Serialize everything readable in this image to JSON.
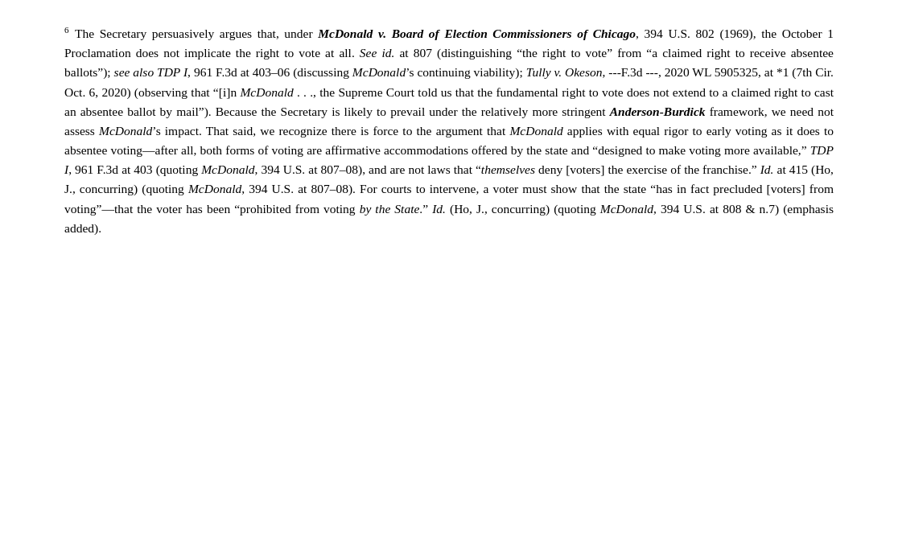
{
  "page": {
    "background_color": "#ffffff",
    "text_color": "#000000"
  },
  "footnote": {
    "number": "6",
    "content": "The Secretary persuasively argues that, under McDonald v. Board of Election Commissioners of Chicago, 394 U.S. 802 (1969), the October 1 Proclamation does not implicate the right to vote at all. See id. at 807 (distinguishing \"the right to vote\" from \"a claimed right to receive absentee ballots\"); see also TDP I, 961 F.3d at 403–06 (discussing McDonald's continuing viability); Tully v. Okeson, ---F.3d ---, 2020 WL 5905325, at *1 (7th Cir. Oct. 6, 2020) (observing that \"[i]n McDonald . . ., the Supreme Court told us that the fundamental right to vote does not extend to a claimed right to cast an absentee ballot by mail\"). Because the Secretary is likely to prevail under the relatively more stringent Anderson-Burdick framework, we need not assess McDonald's impact. That said, we recognize there is force to the argument that McDonald applies with equal rigor to early voting as it does to absentee voting—after all, both forms of voting are affirmative accommodations offered by the state and \"designed to make voting more available,\" TDP I, 961 F.3d at 403 (quoting McDonald, 394 U.S. at 807–08), and are not laws that \"themselves deny [voters] the exercise of the franchise.\" Id. at 415 (Ho, J., concurring) (quoting McDonald, 394 U.S. at 807–08). For courts to intervene, a voter must show that the state \"has in fact precluded [voters] from voting\"—that the voter has been \"prohibited from voting by the State.\" Id. (Ho, J., concurring) (quoting McDonald, 394 U.S. at 808 & n.7) (emphasis added)."
  }
}
